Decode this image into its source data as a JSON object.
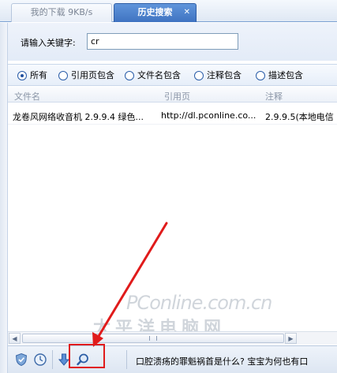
{
  "tabs": [
    {
      "label": "我的下载 9KB/s",
      "active": false
    },
    {
      "label": "历史搜索",
      "active": true,
      "close": "✕"
    }
  ],
  "search": {
    "label": "请输入关键字:",
    "value": "cr"
  },
  "filters": [
    {
      "label": "所有",
      "checked": true
    },
    {
      "label": "引用页包含",
      "checked": false
    },
    {
      "label": "文件名包含",
      "checked": false
    },
    {
      "label": "注释包含",
      "checked": false
    },
    {
      "label": "描述包含",
      "checked": false
    }
  ],
  "table": {
    "headers": [
      "文件名",
      "引用页",
      "注释"
    ],
    "rows": [
      [
        "龙卷风网络收音机 2.9.9.4 绿色...",
        "http://dl.pconline.co...",
        "2.9.9.5(本地电信"
      ]
    ]
  },
  "ticker": "口腔溃疡的罪魁祸首是什么? 宝宝为何也有口",
  "watermark": {
    "line1": "PConline.com.cn",
    "line2": "太平洋电脑网"
  },
  "colors": {
    "accent": "#3f73c1",
    "annotation": "#e01b1b"
  },
  "icons": [
    "shield-icon",
    "clock-icon",
    "download-arrow-icon",
    "search-icon"
  ]
}
